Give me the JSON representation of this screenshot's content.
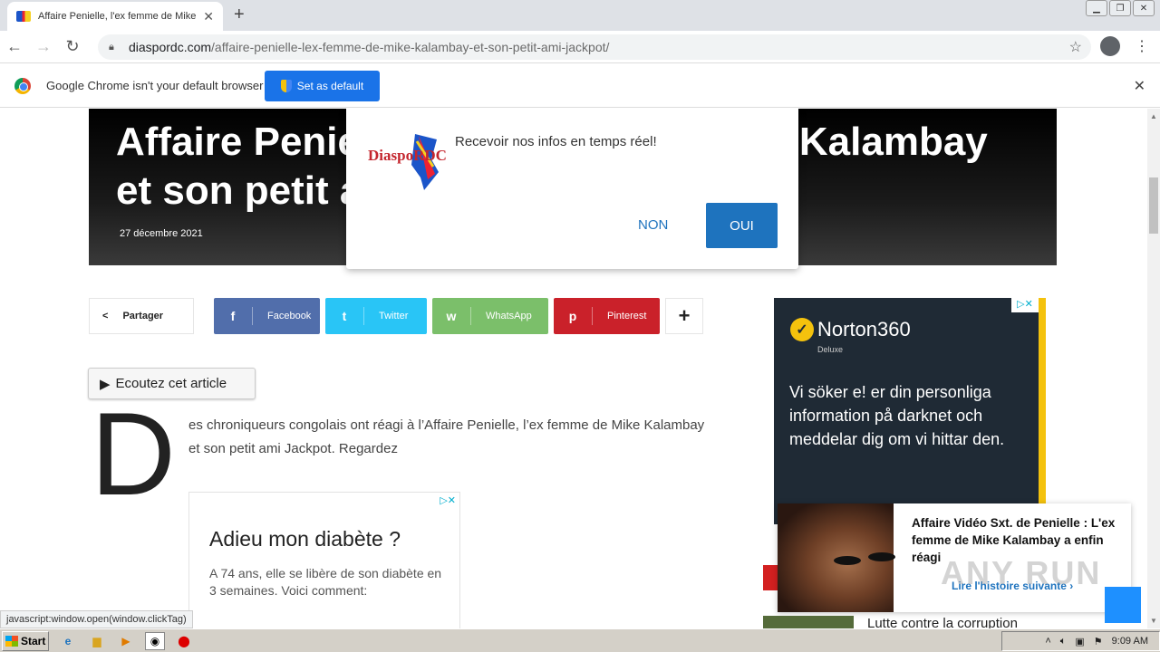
{
  "browser": {
    "tab_title": "Affaire Penielle, l'ex femme de Mike Kalambay",
    "tab_close": "✕",
    "new_tab": "+",
    "url_host": "diaspordc.com",
    "url_path": "/affaire-penielle-lex-femme-de-mike-kalambay-et-son-petit-ami-jackpot/",
    "infobar_text": "Google Chrome isn't your default browser",
    "set_default_label": "Set as default"
  },
  "article": {
    "title": "Affaire Penielle, l'ex femme de Mike Kalambay et son petit ami Jackpot",
    "date": "27 décembre 2021",
    "share_label": "Partager",
    "share_buttons": [
      {
        "label": "Facebook",
        "icon": "f",
        "color": "#516eab"
      },
      {
        "label": "Twitter",
        "icon": "t",
        "color": "#29c5f6"
      },
      {
        "label": "WhatsApp",
        "icon": "w",
        "color": "#7bbf6a"
      },
      {
        "label": "Pinterest",
        "icon": "p",
        "color": "#ca212a"
      }
    ],
    "listen_label": "Ecoutez cet article",
    "drop_cap": "D",
    "body": "es chroniqueurs congolais ont réagi à l’Affaire Penielle, l’ex femme de Mike Kalambay et son petit ami Jackpot. Regardez"
  },
  "notification_modal": {
    "logo_text": "DiaspoRDC",
    "message": "Recevoir nos infos en temps réel!",
    "no_label": "NON",
    "yes_label": "OUI"
  },
  "ad_left": {
    "headline": "Adieu mon diabète ?",
    "text": "A 74 ans, elle se libère de son diabète en 3 semaines. Voici comment:"
  },
  "ad_right": {
    "brand": "Norton360",
    "sub": "Deluxe",
    "body": "Vi söker e! er din personliga information på darknet och meddelar dig om vi hittar den."
  },
  "related_popup": {
    "title": "Affaire Vidéo Sxt. de Penielle : L'ex femme de Mike Kalambay a enfin réagi",
    "more": "Lire l'histoire suivante ›"
  },
  "next_article": "Lutte contre la corruption",
  "watermark": "ANY RUN",
  "status_bar": "javascript:window.open(window.clickTag)",
  "taskbar": {
    "start": "Start",
    "clock": "9:09 AM"
  }
}
